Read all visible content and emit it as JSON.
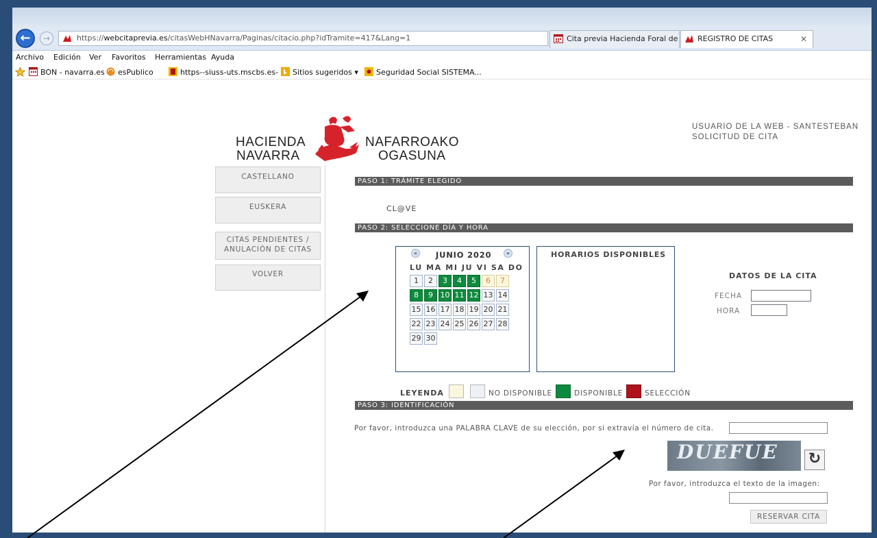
{
  "browser": {
    "url_prefix": "https://",
    "url_domain": "webcitaprevia.es",
    "url_path": "/citasWebHNavarra/Paginas/citacio.php?idTramite=417&Lang=1",
    "tabs": [
      {
        "label": "Cita previa Hacienda Foral de ...",
        "active": false
      },
      {
        "label": "REGISTRO DE CITAS",
        "active": true
      }
    ],
    "menu": [
      "Archivo",
      "Edición",
      "Ver",
      "Favoritos",
      "Herramientas",
      "Ayuda"
    ],
    "favorites": [
      {
        "label": "BON - navarra.es",
        "icon": "bon-icon"
      },
      {
        "label": "esPublico",
        "icon": "espublico-icon"
      },
      {
        "label": "https--siuss-uts.mscbs.es-",
        "icon": "siuss-icon"
      },
      {
        "label": "Sitios sugeridos ▾",
        "icon": "bing-icon"
      },
      {
        "label": "Seguridad Social SISTEMA...",
        "icon": "seguridad-social-icon"
      }
    ],
    "colors": {
      "frame": "#2a4d78",
      "back_button": "#2d6fcf"
    }
  },
  "header": {
    "logo_left_1": "HACIENDA",
    "logo_left_2": "NAVARRA",
    "logo_right_1": "NAFARROAKO",
    "logo_right_2": "OGASUNA",
    "user_line": "USUARIO DE LA WEB - SANTESTEBAN",
    "request_line": "SOLICITUD DE CITA"
  },
  "sidebar": {
    "castellano": "CASTELLANO",
    "euskera": "EUSKERA",
    "pending_1": "CITAS PENDIENTES /",
    "pending_2": "ANULACIÓN DE CITAS",
    "back": "VOLVER"
  },
  "step1": {
    "title": "PASO 1: TRÁMITE ELEGIDO",
    "value": "CL@VE"
  },
  "step2": {
    "title": "PASO 2: SELECCIONE DÍA Y HORA",
    "month_title": "JUNIO 2020",
    "weekdays": "LU MA MI JU VI SA DO",
    "days": [
      {
        "d": "1",
        "state": "unavailable"
      },
      {
        "d": "2",
        "state": "unavailable"
      },
      {
        "d": "3",
        "state": "available"
      },
      {
        "d": "4",
        "state": "available"
      },
      {
        "d": "5",
        "state": "available"
      },
      {
        "d": "6",
        "state": "weekend"
      },
      {
        "d": "7",
        "state": "weekend"
      },
      {
        "d": "8",
        "state": "available"
      },
      {
        "d": "9",
        "state": "available"
      },
      {
        "d": "10",
        "state": "available"
      },
      {
        "d": "11",
        "state": "available"
      },
      {
        "d": "12",
        "state": "available"
      },
      {
        "d": "13",
        "state": "unavailable"
      },
      {
        "d": "14",
        "state": "unavailable"
      },
      {
        "d": "15",
        "state": "unavailable"
      },
      {
        "d": "16",
        "state": "unavailable"
      },
      {
        "d": "17",
        "state": "unavailable"
      },
      {
        "d": "18",
        "state": "unavailable"
      },
      {
        "d": "19",
        "state": "unavailable"
      },
      {
        "d": "20",
        "state": "unavailable"
      },
      {
        "d": "21",
        "state": "unavailable"
      },
      {
        "d": "22",
        "state": "unavailable"
      },
      {
        "d": "23",
        "state": "unavailable"
      },
      {
        "d": "24",
        "state": "unavailable"
      },
      {
        "d": "25",
        "state": "unavailable"
      },
      {
        "d": "26",
        "state": "unavailable"
      },
      {
        "d": "27",
        "state": "unavailable"
      },
      {
        "d": "28",
        "state": "unavailable"
      },
      {
        "d": "29",
        "state": "unavailable"
      },
      {
        "d": "30",
        "state": "unavailable"
      }
    ],
    "horarios_title": "HORARIOS DISPONIBLES",
    "datos_title": "DATOS DE LA CITA",
    "fecha_label": "FECHA",
    "hora_label": "HORA",
    "fecha_value": "",
    "hora_value": ""
  },
  "legend": {
    "title": "LEYENDA",
    "no_disponible": "NO DISPONIBLE",
    "disponible": "DISPONIBLE",
    "seleccion": "SELECCIÓN",
    "colors": {
      "weekend": "#fbf7df",
      "no_disponible": "#eef1f5",
      "disponible": "#0e8a3e",
      "seleccion": "#b0121b"
    }
  },
  "step3": {
    "title": "PASO 3: IDENTIFICACIÓN",
    "keyword_prompt": "Por favor, introduzca una PALABRA CLAVE de su elección, por si extravía el número de cita.",
    "keyword_value": "",
    "captcha_text": "DUEFUE",
    "captcha_prompt": "Por favor, introduzca el texto de la imagen:",
    "captcha_value": "",
    "reserve_button": "RESERVAR CITA"
  }
}
